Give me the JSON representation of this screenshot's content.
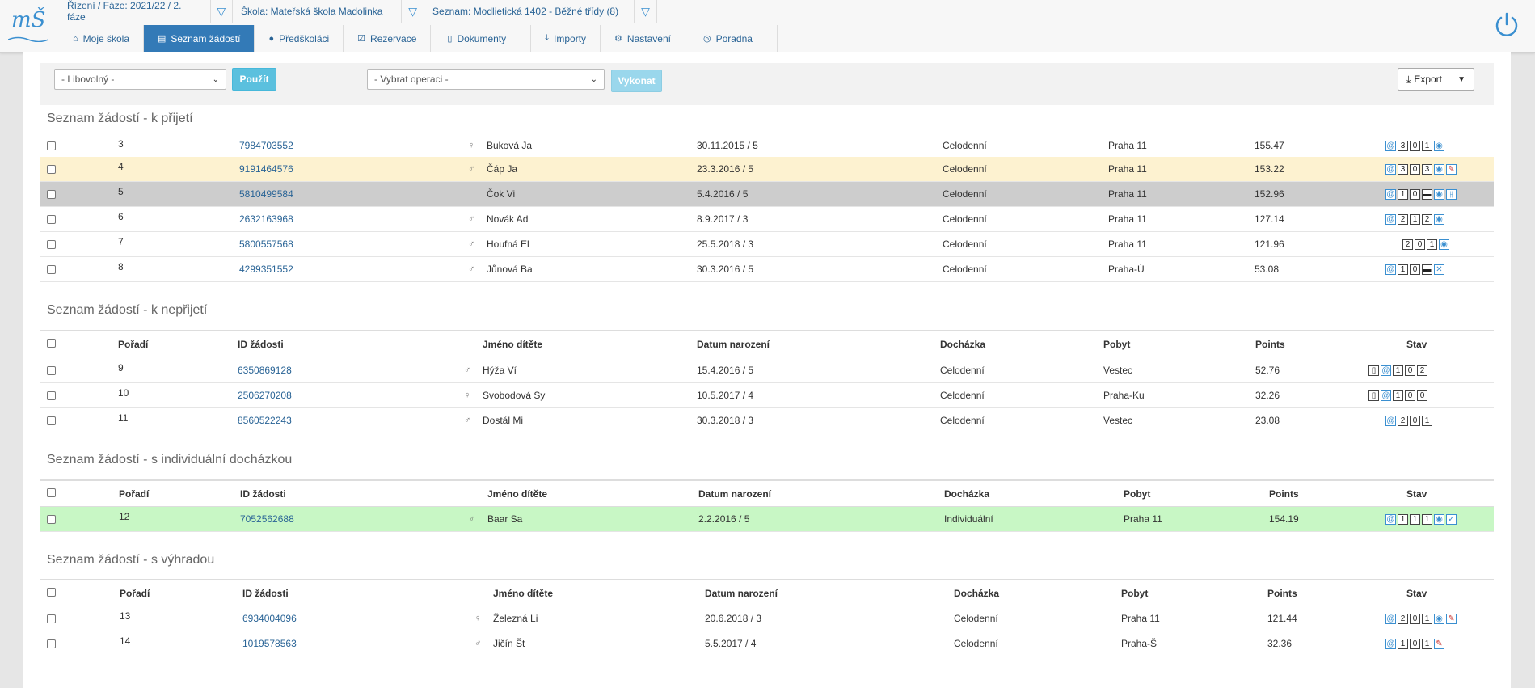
{
  "logo": {
    "text": "mŠ"
  },
  "filters": [
    {
      "label": "Řízení / Fáze: 2021/22 / 2. fáze"
    },
    {
      "label": "Škola: Mateřská škola Madolinka"
    },
    {
      "label": "Seznam: Modlietická 1402 - Běžné třídy (8)"
    }
  ],
  "tabs": [
    {
      "label": "Moje škola",
      "icon": "home-icon"
    },
    {
      "label": "Seznam žádostí",
      "icon": "document-icon",
      "active": true
    },
    {
      "label": "Předškoláci",
      "icon": "user-icon"
    },
    {
      "label": "Rezervace",
      "icon": "check-square-icon"
    },
    {
      "label": "Dokumenty",
      "icon": "file-icon"
    },
    {
      "label": "Importy",
      "icon": "download-icon"
    },
    {
      "label": "Nastavení",
      "icon": "gears-icon"
    },
    {
      "label": "Poradna",
      "icon": "lifebuoy-icon"
    }
  ],
  "toolbar": {
    "filter_select": "- Libovolný -",
    "use_label": "Použít",
    "operation_select": "- Vybrat operaci -",
    "execute_label": "Vykonat",
    "export_label": "Export"
  },
  "columns": {
    "order": "Pořadí",
    "id": "ID žádosti",
    "name": "Jméno dítěte",
    "dob": "Datum narození",
    "attendance": "Docházka",
    "residence": "Pobyt",
    "points": "Points",
    "state": "Stav"
  },
  "sections": [
    {
      "title": "Seznam žádostí - k přijetí",
      "rows": [
        {
          "order": "3",
          "id": "7984703552",
          "gender": "♀",
          "name": "Buková Ja",
          "dob": "30.11.2015 / 5",
          "attendance": "Celodenní",
          "residence": "Praha 11",
          "points": "155.47",
          "state": [
            "@",
            "3",
            "0",
            "1",
            "◉"
          ],
          "style": ""
        },
        {
          "order": "4",
          "id": "9191464576",
          "gender": "♂",
          "name": "Čáp Ja",
          "dob": "23.3.2016 / 5",
          "attendance": "Celodenní",
          "residence": "Praha 11",
          "points": "153.22",
          "state": [
            "@",
            "3",
            "0",
            "3",
            "◉",
            "✎"
          ],
          "style": "yellow"
        },
        {
          "order": "5",
          "id": "5810499584",
          "gender": "",
          "name": "Čok Vi",
          "dob": "5.4.2016 / 5",
          "attendance": "Celodenní",
          "residence": "Praha 11",
          "points": "152.96",
          "state": [
            "@",
            "1",
            "0",
            "▬",
            "◉",
            "⫲"
          ],
          "style": "gray"
        },
        {
          "order": "6",
          "id": "2632163968",
          "gender": "♂",
          "name": "Novák Ad",
          "dob": "8.9.2017 / 3",
          "attendance": "Celodenní",
          "residence": "Praha 11",
          "points": "127.14",
          "state": [
            "@",
            "2",
            "1",
            "2",
            "◉"
          ],
          "style": ""
        },
        {
          "order": "7",
          "id": "5800557568",
          "gender": "♂",
          "name": "Houfná El",
          "dob": "25.5.2018 / 3",
          "attendance": "Celodenní",
          "residence": "Praha 11",
          "points": "121.96",
          "state": [
            "2",
            "0",
            "1",
            "◉"
          ],
          "style": ""
        },
        {
          "order": "8",
          "id": "4299351552",
          "gender": "♂",
          "name": "Jůnová Ba",
          "dob": "30.3.2016 / 5",
          "attendance": "Celodenní",
          "residence": "Praha-Ú",
          "points": "53.08",
          "state": [
            "@",
            "1",
            "0",
            "▬",
            "✕"
          ],
          "style": ""
        }
      ]
    },
    {
      "title": "Seznam žádostí - k nepřijetí",
      "rows": [
        {
          "order": "9",
          "id": "6350869128",
          "gender": "♂",
          "name": "Hýža Ví",
          "dob": "15.4.2016 / 5",
          "attendance": "Celodenní",
          "residence": "Vestec",
          "points": "52.76",
          "state": [
            "▯",
            "@",
            "1",
            "0",
            "2"
          ],
          "style": ""
        },
        {
          "order": "10",
          "id": "2506270208",
          "gender": "♀",
          "name": "Svobodová Sy",
          "dob": "10.5.2017 / 4",
          "attendance": "Celodenní",
          "residence": "Praha-Ku",
          "points": "32.26",
          "state": [
            "▯",
            "@",
            "1",
            "0",
            "0"
          ],
          "style": ""
        },
        {
          "order": "11",
          "id": "8560522243",
          "gender": "♂",
          "name": "Dostál Mi",
          "dob": "30.3.2018 / 3",
          "attendance": "Celodenní",
          "residence": "Vestec",
          "points": "23.08",
          "state": [
            "@",
            "2",
            "0",
            "1"
          ],
          "style": ""
        }
      ]
    },
    {
      "title": "Seznam žádostí - s individuální docházkou",
      "rows": [
        {
          "order": "12",
          "id": "7052562688",
          "gender": "♂",
          "name": "Baar Sa",
          "dob": "2.2.2016 / 5",
          "attendance": "Individuální",
          "residence": "Praha 11",
          "points": "154.19",
          "state": [
            "@",
            "1",
            "1",
            "1",
            "◉",
            "✓"
          ],
          "style": "green"
        }
      ]
    },
    {
      "title": "Seznam žádostí - s výhradou",
      "rows": [
        {
          "order": "13",
          "id": "6934004096",
          "gender": "♀",
          "name": "Železná Li",
          "dob": "20.6.2018 / 3",
          "attendance": "Celodenní",
          "residence": "Praha 11",
          "points": "121.44",
          "state": [
            "@",
            "2",
            "0",
            "1",
            "◉",
            "✎"
          ],
          "style": ""
        },
        {
          "order": "14",
          "id": "1019578563",
          "gender": "♂",
          "name": "Jičín Št",
          "dob": "5.5.2017 / 4",
          "attendance": "Celodenní",
          "residence": "Praha-Š",
          "points": "32.36",
          "state": [
            "@",
            "1",
            "0",
            "1",
            "✎"
          ],
          "style": ""
        }
      ]
    }
  ],
  "colors": {
    "accent": "#337ab7",
    "yellow_row": "#fdf2d0",
    "gray_row": "#cdcdcd",
    "green_row": "#c8f7c5"
  }
}
